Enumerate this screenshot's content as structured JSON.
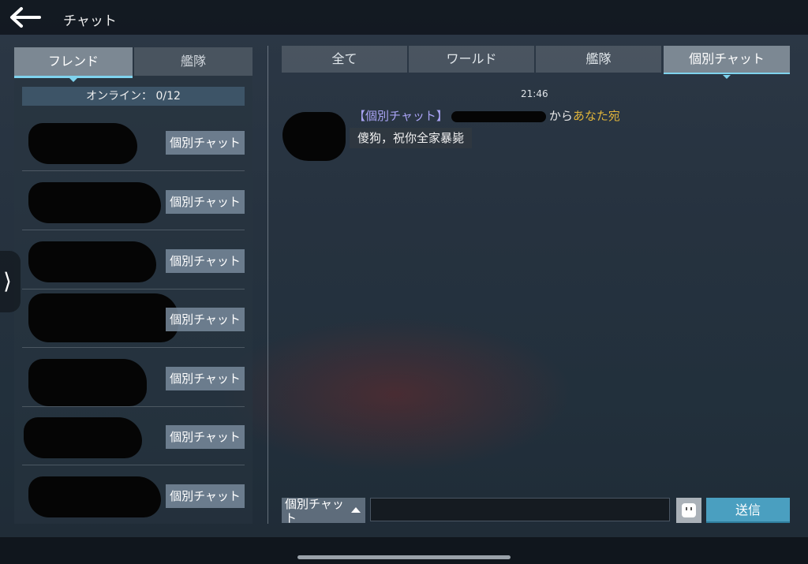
{
  "header": {
    "title": "チャット"
  },
  "left_panel": {
    "tabs": [
      {
        "label": "フレンド",
        "active": true
      },
      {
        "label": "艦隊",
        "active": false
      }
    ],
    "online_label": "オンライン： 0/12",
    "friends": [
      {
        "button": "個別チャット"
      },
      {
        "button": "個別チャット"
      },
      {
        "button": "個別チャット"
      },
      {
        "button": "個別チャット"
      },
      {
        "button": "個別チャット"
      },
      {
        "button": "個別チャット"
      },
      {
        "button": "個別チャット"
      }
    ]
  },
  "channel_tabs": [
    {
      "label": "全て",
      "active": false
    },
    {
      "label": "ワールド",
      "active": false
    },
    {
      "label": "艦隊",
      "active": false
    },
    {
      "label": "個別チャット",
      "active": true
    }
  ],
  "messages": [
    {
      "time": "21:46",
      "channel_tag": "【個別チャット】",
      "from_text": "から",
      "to_text": "あなた宛",
      "body": "傻狗，祝你全家暴毙"
    }
  ],
  "composer": {
    "channel": "個別チャット",
    "input_value": "",
    "send_label": "送信",
    "emoji_icon": "emoji-icon"
  },
  "colors": {
    "accent": "#7fd3ee",
    "send": "#4a9fc0",
    "tag": "#a9a3f4",
    "you": "#e0b43a"
  }
}
